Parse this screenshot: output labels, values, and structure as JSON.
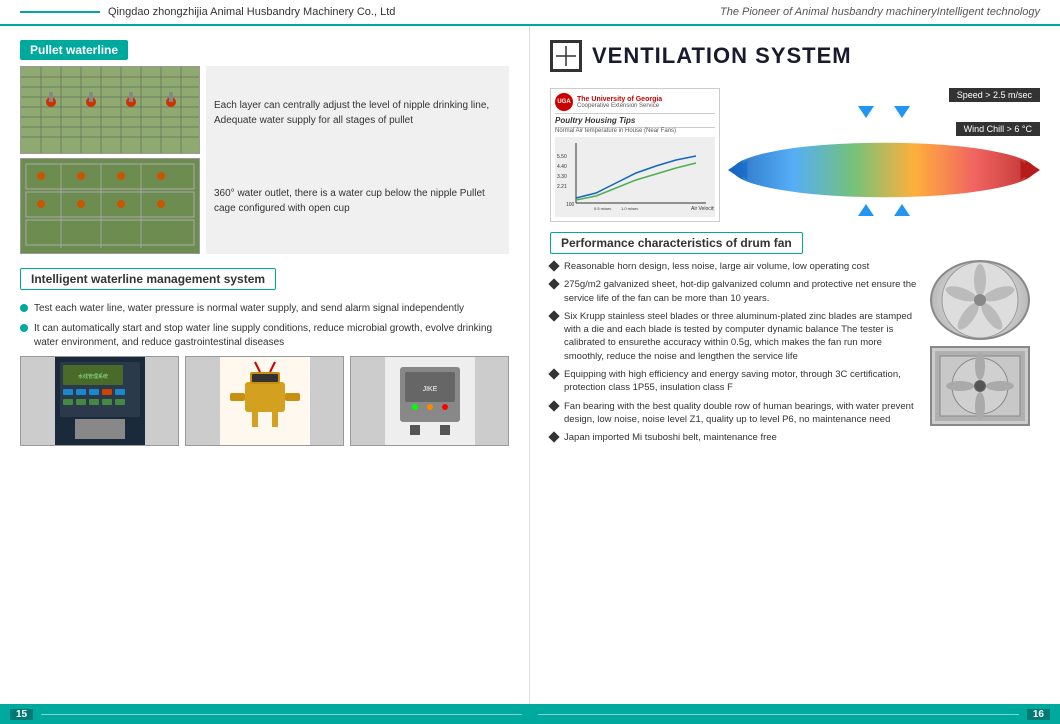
{
  "header": {
    "company": "Qingdao zhongzhijia Animal Husbandry Machinery Co., Ltd",
    "tagline": "The Pioneer of Animal husbandry machineryIntelligent technology",
    "line_color": "#00a99d"
  },
  "left_page": {
    "page_number": "15",
    "section1": {
      "badge": "Pullet waterline",
      "text1": "Each layer can centrally adjust the level of nipple drinking line,\nAdequate water supply for all stages of pullet",
      "text2": "360° water outlet, there is a water cup below the nipple\nPullet cage configured with open cup"
    },
    "section2": {
      "badge": "Intelligent waterline management system",
      "bullet1": "Test each water line, water pressure is normal water supply, and send alarm signal independently",
      "bullet2": "It can automatically start and stop water line supply conditions, reduce microbial growth, evolve  drinking  water environment, and reduce gastrointestinal diseases"
    }
  },
  "right_page": {
    "page_number": "16",
    "ventilation_title": "VENTILATION SYSTEM",
    "poultry_tips": {
      "title": "Poultry Housing Tips",
      "speed_label": "Speed > 2.5 m/sec",
      "windchill_label": "Wind Chill > 6 °C"
    },
    "perf_section": {
      "badge": "Performance characteristics of drum fan",
      "bullets": [
        "Reasonable horn design, less noise, large air volume, low operating cost",
        "275g/m2 galvanized sheet, hot-dip galvanized column and protective net ensure the service life of the fan can be more than 10 years.",
        "Six Krupp stainless steel blades or three aluminum-plated zinc blades are stamped with a die and each blade is tested by computer dynamic balance    The tester is calibrated to ensurethe accuracy within 0.5g, which makes the fan run more smoothly, reduce the noise and lengthen the service life",
        "Equipping with high efficiency and energy saving motor, through 3C certification, protection class 1P55, insulation class F",
        "Fan bearing with the best quality double row of human bearings, with water prevent design, low noise, noise level Z1, quality up to level P6, no maintenance need",
        "Japan imported Mi tsuboshi belt, maintenance free"
      ]
    }
  }
}
